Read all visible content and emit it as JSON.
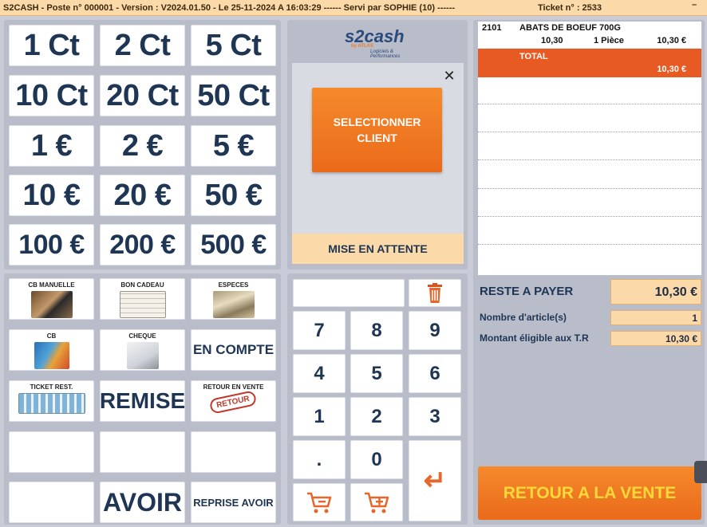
{
  "topbar": {
    "info": "S2CASH - Poste n° 000001 - Version : V2024.01.50 - Le 25-11-2024 A 16:03:29 ------ Servi par SOPHIE (10) ------",
    "ticket": "Ticket n° : 2533",
    "minimize": "–"
  },
  "money": [
    "1 Ct",
    "2 Ct",
    "5 Ct",
    "10 Ct",
    "20 Ct",
    "50 Ct",
    "1 €",
    "2 €",
    "5 €",
    "10 €",
    "20 €",
    "50 €",
    "100 €",
    "200 €",
    "500 €"
  ],
  "logo": {
    "main": "s2cash",
    "sub": "by ATLAS",
    "tagline": "Logiciels & Performances"
  },
  "client": {
    "close": "✕",
    "select_line1": "SELECTIONNER",
    "select_line2": "CLIENT",
    "hold": "MISE EN ATTENTE"
  },
  "payments": {
    "cb_manuelle": "CB MANUELLE",
    "bon_cadeau": "BON CADEAU",
    "especes": "ESPECES",
    "cb": "CB",
    "cheque": "CHEQUE",
    "en_compte": "EN COMPTE",
    "ticket_rest": "TICKET REST.",
    "remise": "REMISE",
    "retour_en_vente": "RETOUR EN VENTE",
    "retour_stamp": "RETOUR",
    "avoir": "AVOIR",
    "reprise_avoir": "REPRISE AVOIR"
  },
  "keypad": {
    "k7": "7",
    "k8": "8",
    "k9": "9",
    "k4": "4",
    "k5": "5",
    "k6": "6",
    "k1": "1",
    "k2": "2",
    "k3": "3",
    "dot": ".",
    "k0": "0",
    "enter": "↵"
  },
  "ticket": {
    "item": {
      "code": "2101",
      "name": "ABATS DE BOEUF 700G",
      "unit_price": "10,30",
      "qty": "1 Pièce",
      "total": "10,30 €"
    },
    "total_label": "TOTAL",
    "total_value": "10,30 €"
  },
  "summary": {
    "reste_label": "RESTE A PAYER",
    "reste_value": "10,30 €",
    "nb_label": "Nombre d'article(s)",
    "nb_value": "1",
    "tr_label": "Montant éligible aux T.R",
    "tr_value": "10,30 €"
  },
  "retour_button": "RETOUR A LA VENTE",
  "colors": {
    "accent": "#f07a22",
    "navy": "#1e3554",
    "peach": "#fbd9a8"
  }
}
